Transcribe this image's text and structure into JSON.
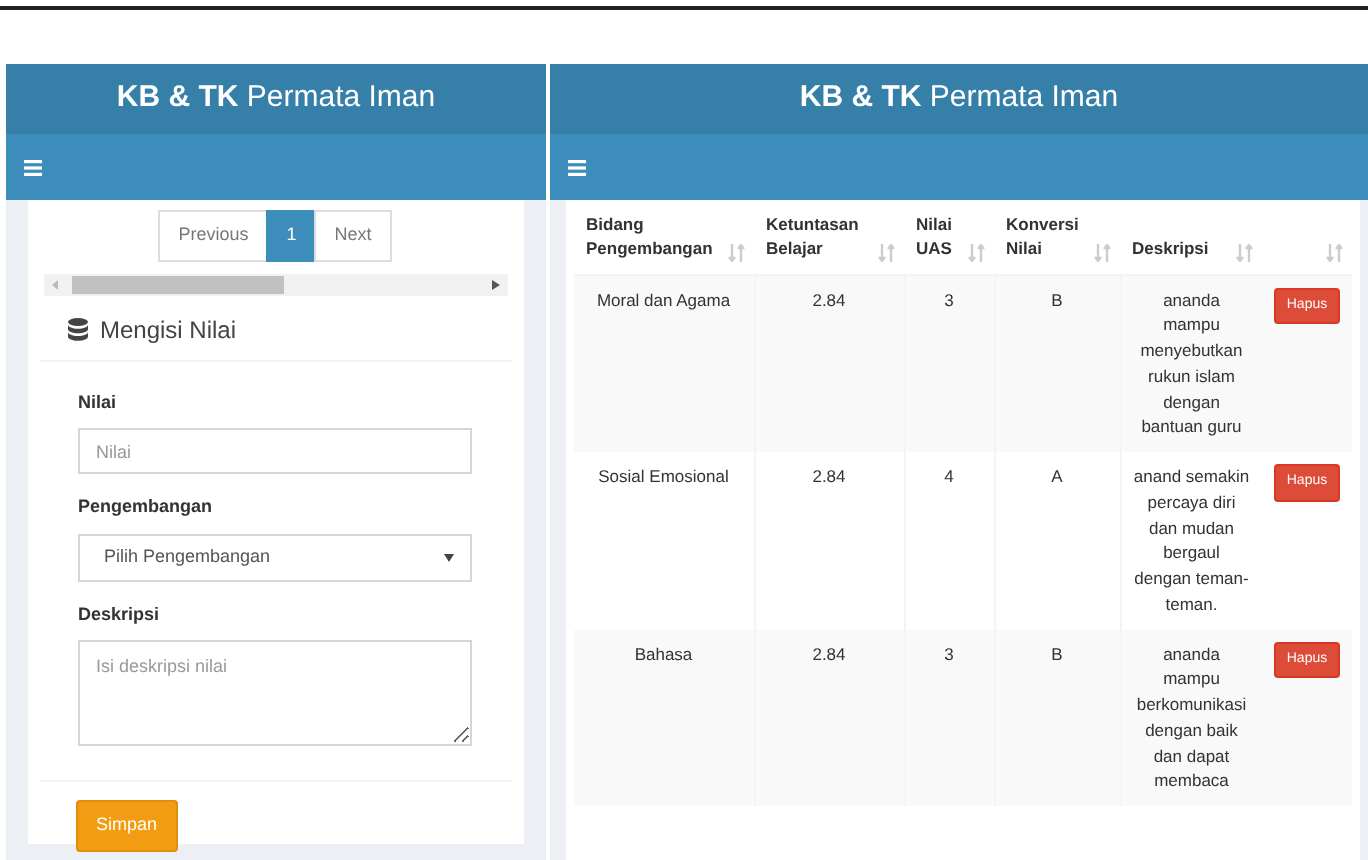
{
  "left_panel": {
    "header_title": "**KB & TK** Permata Iman",
    "pagination": [
      {
        "label": "Previous",
        "selected": false
      },
      {
        "label": "1",
        "selected": true
      },
      {
        "label": "Next",
        "selected": false
      }
    ],
    "box_title": "Mengisi Nilai",
    "fields": [
      {
        "kind": "input",
        "label": "Nilai",
        "placeholder": "Nilai"
      },
      {
        "kind": "select",
        "label": "Pengembangan",
        "value": "Pilih Pengembangan"
      },
      {
        "kind": "textarea",
        "label": "Deskripsi",
        "placeholder": "Isi deskripsi nilai"
      }
    ],
    "submit": "Simpan"
  },
  "right_panel": {
    "header_title": "**KB & TK** Permata Iman",
    "table": {
      "columns": [
        "Bidang Pengembangan",
        "Ketuntasan Belajar",
        "Nilai UAS",
        "Konversi Nilai",
        "Deskripsi",
        ""
      ],
      "rows": [
        {
          "cells": [
            "Moral dan Agama",
            "2.84",
            "3",
            "B",
            "ananda mampu menyebutkan rukun islam dengan bantuan guru"
          ],
          "action": "Hapus"
        },
        {
          "cells": [
            "Sosial Emosional",
            "2.84",
            "4",
            "A",
            "anand semakin percaya diri dan mudan bergaul dengan teman-teman."
          ],
          "action": "Hapus"
        },
        {
          "cells": [
            "Bahasa",
            "2.84",
            "3",
            "B",
            "ananda mampu berkomunikasi dengan baik dan dapat membaca"
          ],
          "action": "Hapus"
        }
      ]
    }
  }
}
